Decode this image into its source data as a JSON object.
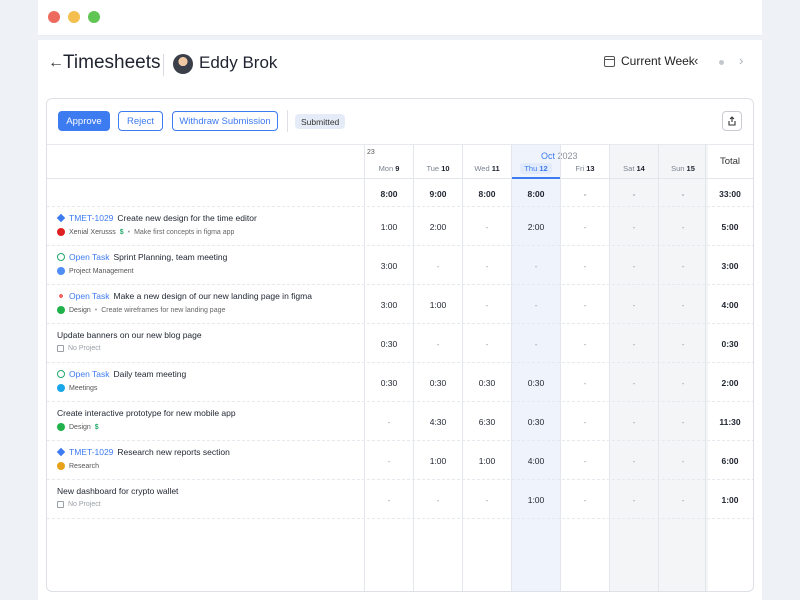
{
  "header": {
    "back_arrow": "←",
    "title": "Timesheets",
    "user_name": "Eddy Brok",
    "week_label": "Current Week",
    "prev_arrow": "‹",
    "next_arrow": "›"
  },
  "toolbar": {
    "approve": "Approve",
    "reject": "Reject",
    "withdraw": "Withdraw Submission",
    "status": "Submitted"
  },
  "calendar": {
    "week_number": "23",
    "month": "Oct",
    "year": "2023",
    "total_label": "Total",
    "days": [
      {
        "name": "Mon",
        "num": "9",
        "today": false
      },
      {
        "name": "Tue",
        "num": "10",
        "today": false
      },
      {
        "name": "Wed",
        "num": "11",
        "today": false
      },
      {
        "name": "Thu",
        "num": "12",
        "today": true
      },
      {
        "name": "Fri",
        "num": "13",
        "today": false
      },
      {
        "name": "Sat",
        "num": "14",
        "today": false
      },
      {
        "name": "Sun",
        "num": "15",
        "today": false
      }
    ],
    "day_totals": [
      "8:00",
      "9:00",
      "8:00",
      "8:00",
      "-",
      "-",
      "-"
    ],
    "week_total": "33:00"
  },
  "tasks": [
    {
      "icon": "jira-diamond-icon",
      "key": "TMET-1029",
      "title": "Create new design for the time editor",
      "project": "Xenial Xerusss",
      "project_color": "#e02020",
      "billable": true,
      "note": "Make first concepts in figma app",
      "hours": [
        "1:00",
        "2:00",
        "-",
        "2:00",
        "-",
        "-",
        "-"
      ],
      "total": "5:00"
    },
    {
      "icon": "check-circle-icon",
      "key": "Open Task",
      "title": "Sprint Planning, team meeting",
      "project": "Project Management",
      "project_color": "#4f8ef7",
      "billable": false,
      "note": "",
      "hours": [
        "3:00",
        "-",
        "-",
        "-",
        "-",
        "-",
        "-"
      ],
      "total": "3:00"
    },
    {
      "icon": "asana-icon",
      "key": "Open Task",
      "title": "Make a new design of our new landing page in figma",
      "project": "Design",
      "project_color": "#21b14b",
      "billable": false,
      "note": "Create wireframes for new landing page",
      "hours": [
        "3:00",
        "1:00",
        "-",
        "-",
        "-",
        "-",
        "-"
      ],
      "total": "4:00"
    },
    {
      "icon": "",
      "key": "",
      "title": "Update banners on our new blog page",
      "project": "No Project",
      "project_color": "",
      "billable": false,
      "note": "",
      "hours": [
        "0:30",
        "-",
        "-",
        "-",
        "-",
        "-",
        "-"
      ],
      "total": "0:30"
    },
    {
      "icon": "check-circle-icon",
      "key": "Open Task",
      "title": "Daily team meeting",
      "project": "Meetings",
      "project_color": "#1aa6e8",
      "billable": false,
      "note": "",
      "hours": [
        "0:30",
        "0:30",
        "0:30",
        "0:30",
        "-",
        "-",
        "-"
      ],
      "total": "2:00"
    },
    {
      "icon": "",
      "key": "",
      "title": "Create interactive prototype for new mobile app",
      "project": "Design",
      "project_color": "#21b14b",
      "billable": true,
      "note": "",
      "hours": [
        "-",
        "4:30",
        "6:30",
        "0:30",
        "-",
        "-",
        "-"
      ],
      "total": "11:30"
    },
    {
      "icon": "jira-diamond-icon",
      "key": "TMET-1029",
      "title": "Research new reports section",
      "project": "Research",
      "project_color": "#e8a11a",
      "billable": false,
      "note": "",
      "hours": [
        "-",
        "1:00",
        "1:00",
        "4:00",
        "-",
        "-",
        "-"
      ],
      "total": "6:00"
    },
    {
      "icon": "",
      "key": "",
      "title": "New dashboard for crypto wallet",
      "project": "No Project",
      "project_color": "",
      "billable": false,
      "note": "",
      "hours": [
        "-",
        "-",
        "-",
        "1:00",
        "-",
        "-",
        "-"
      ],
      "total": "1:00"
    }
  ],
  "colors": {
    "accent": "#3d7bf0",
    "today_bg": "#eef3fc",
    "weekend_bg": "#f4f5f7"
  }
}
